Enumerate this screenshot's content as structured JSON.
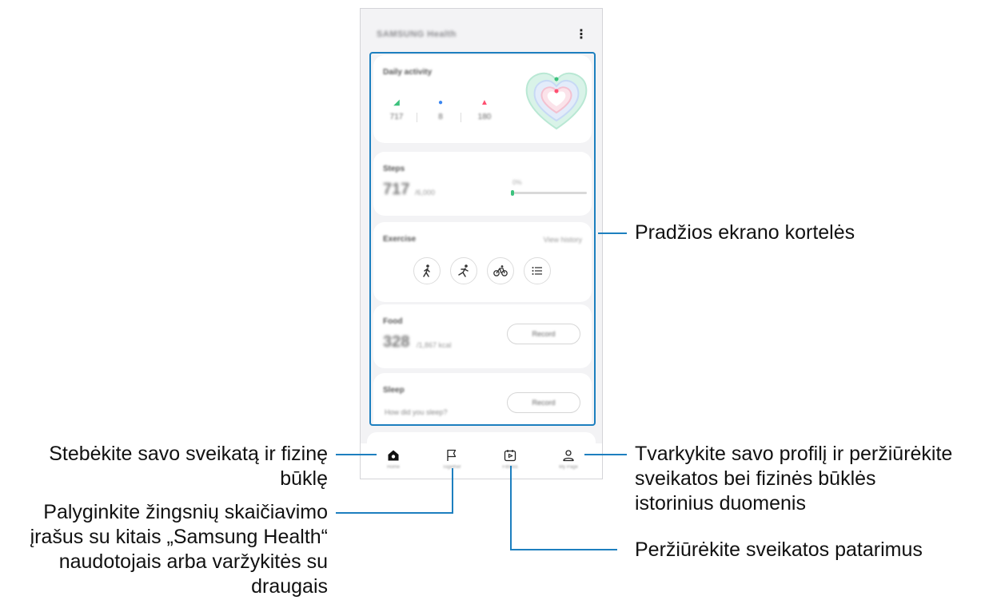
{
  "app": {
    "title": "SAMSUNG Health",
    "menu_icon": "more-vertical-icon"
  },
  "cards": {
    "daily_activity": {
      "title": "Daily activity",
      "steps": "717",
      "active_minutes": "8",
      "calories": "180",
      "colors": {
        "steps": "#3cc27d",
        "minutes": "#3a86f0",
        "calories": "#ff4f70"
      }
    },
    "steps": {
      "title": "Steps",
      "value": "717",
      "unit": "/6,000",
      "goal_label": "0%",
      "progress": 0.04
    },
    "exercise": {
      "title": "Exercise",
      "link": "View history",
      "buttons": [
        "walking-icon",
        "running-icon",
        "cycling-icon",
        "list-icon"
      ]
    },
    "food": {
      "title": "Food",
      "value": "328",
      "unit": "/1,867 kcal",
      "button": "Record"
    },
    "sleep": {
      "title": "Sleep",
      "question": "How did you sleep?",
      "button": "Record"
    }
  },
  "nav": {
    "items": [
      {
        "label": "Home",
        "icon": "home-icon"
      },
      {
        "label": "Together",
        "icon": "flag-icon"
      },
      {
        "label": "Fitness",
        "icon": "play-calendar-icon"
      },
      {
        "label": "My Page",
        "icon": "person-icon"
      }
    ]
  },
  "callouts": {
    "home_cards": "Pradžios ekrano kortelės",
    "home_tab": [
      "Stebėkite savo sveikatą ir fizinę",
      "būklę"
    ],
    "together_tab": [
      "Palyginkite žingsnių skaičiavimo",
      "įrašus su kitais „Samsung Health“",
      "naudotojais arba varžykitės su",
      "draugais"
    ],
    "mypage_tab": [
      "Tvarkykite savo profilį ir peržiūrėkite",
      "sveikatos bei fizinės būklės",
      "istorinius duomenis"
    ],
    "fitness_tab": "Peržiūrėkite sveikatos patarimus"
  }
}
